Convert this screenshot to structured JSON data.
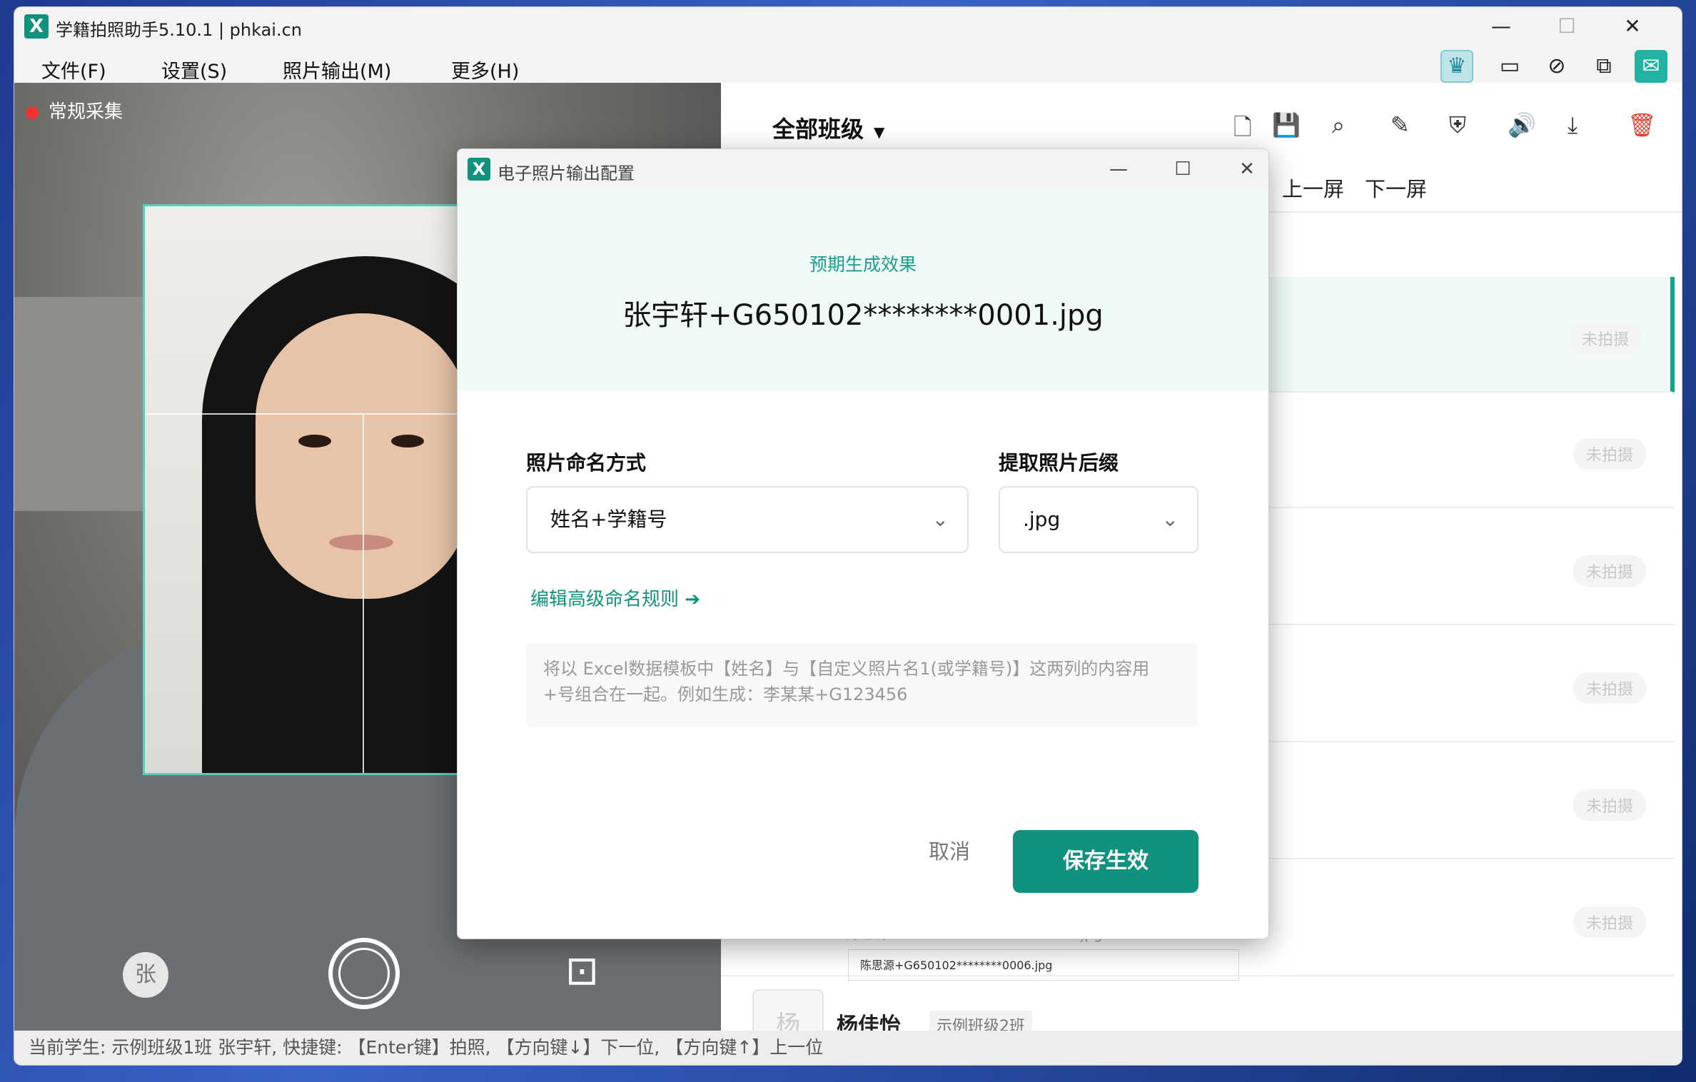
{
  "app": {
    "logo_text": "X",
    "title": "学籍拍照助手5.10.1 | phkai.cn",
    "window_controls": {
      "minimize": "—",
      "maximize": "☐",
      "close": "✕"
    }
  },
  "menu": {
    "items": [
      "文件(F)",
      "设置(S)",
      "照片输出(M)",
      "更多(H)"
    ],
    "top_icons": [
      {
        "name": "crown-icon",
        "glyph": "♛"
      },
      {
        "name": "tablet-icon",
        "glyph": "▭"
      },
      {
        "name": "link-icon",
        "glyph": "⊘"
      },
      {
        "name": "edit-photo-icon",
        "glyph": "⧉"
      },
      {
        "name": "wechat-icon",
        "glyph": "✉"
      }
    ]
  },
  "camera": {
    "mode_label": "常规采集",
    "name_button": "张",
    "add_photo_glyph": "⊡"
  },
  "list": {
    "title": "全部班级",
    "caret": "▼",
    "tools": [
      {
        "name": "add-file-icon",
        "glyph": "🗋"
      },
      {
        "name": "save-icon",
        "glyph": "💾"
      },
      {
        "name": "search-icon",
        "glyph": "⌕"
      },
      {
        "name": "pencil-icon",
        "glyph": "✎"
      },
      {
        "name": "shield-icon",
        "glyph": "⛨"
      },
      {
        "name": "speaker-icon",
        "glyph": "🔊"
      },
      {
        "name": "download-icon",
        "glyph": "⤓"
      },
      {
        "name": "delete-icon",
        "glyph": "🗑"
      }
    ],
    "prev_screen": "上一屏",
    "next_screen": "下一屏",
    "rows": [
      {
        "status": "未拍摄"
      },
      {
        "status": "未拍摄"
      },
      {
        "status": "未拍摄"
      },
      {
        "status": "未拍摄"
      },
      {
        "status": "未拍摄"
      },
      {
        "status": "未拍摄"
      }
    ],
    "partial_file_line": "🗋陈思源+G610102201507070006.jpg",
    "file_box": "陈思源+G650102********0006.jpg",
    "last_student": {
      "avatar": "杨",
      "name": "杨佳怡",
      "class": "示例班级2班"
    }
  },
  "statusbar": {
    "text": "当前学生: 示例班级1班 张宇轩, 快捷键: 【Enter键】拍照, 【方向键↓】下一位, 【方向键↑】上一位"
  },
  "dialog": {
    "logo_text": "X",
    "title": "电子照片输出配置",
    "controls": {
      "minimize": "—",
      "maximize": "☐",
      "close": "✕"
    },
    "preview_label": "预期生成效果",
    "preview_value": "张宇轩+G650102********0001.jpg",
    "naming_label": "照片命名方式",
    "naming_value": "姓名+学籍号",
    "suffix_label": "提取照片后缀",
    "suffix_value": ".jpg",
    "chevron": "⌄",
    "advanced_link": "编辑高级命名规则 ➔",
    "hint": "将以 Excel数据模板中【姓名】与【自定义照片名1(或学籍号)】这两列的内容用+号组合在一起。例如生成：李某某+G123456",
    "cancel": "取消",
    "save": "保存生效"
  }
}
